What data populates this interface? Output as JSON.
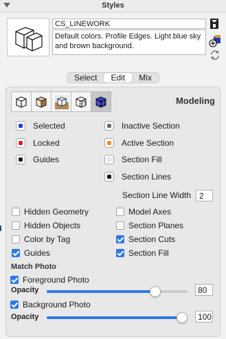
{
  "window": {
    "title": "Styles"
  },
  "style": {
    "name": "CS_LINEWORK",
    "description": "Default colors. Profile Edges. Light blue sky and brown background."
  },
  "tabs": [
    {
      "label": "Select",
      "active": false
    },
    {
      "label": "Edit",
      "active": true
    },
    {
      "label": "Mix",
      "active": false
    }
  ],
  "toolbar": {
    "buttons": [
      {
        "icon": "edge-settings-icon",
        "active": false
      },
      {
        "icon": "face-settings-icon",
        "active": false
      },
      {
        "icon": "background-settings-icon",
        "active": false
      },
      {
        "icon": "watermark-settings-icon",
        "active": false
      },
      {
        "icon": "modeling-settings-icon",
        "active": true
      }
    ],
    "section_title": "Modeling"
  },
  "colors": {
    "left": [
      {
        "label": "Selected",
        "color": "#1f3ed6"
      },
      {
        "label": "Locked",
        "color": "#e01c2a"
      },
      {
        "label": "Guides",
        "color": "#111111"
      }
    ],
    "right": [
      {
        "label": "Inactive Section",
        "color": "#6b6b6b"
      },
      {
        "label": "Active Section",
        "color": "#ee8a22"
      },
      {
        "label": "Section Fill",
        "color": "#f4f4f4"
      },
      {
        "label": "Section Lines",
        "color": "#111111"
      }
    ]
  },
  "section_line_width": {
    "label": "Section Line Width",
    "value": "2"
  },
  "checkboxes": {
    "left": [
      {
        "label": "Hidden Geometry",
        "checked": false
      },
      {
        "label": "Hidden Objects",
        "checked": false
      },
      {
        "label": "Color by Tag",
        "checked": false
      },
      {
        "label": "Guides",
        "checked": true
      }
    ],
    "right": [
      {
        "label": "Model Axes",
        "checked": false
      },
      {
        "label": "Section Planes",
        "checked": false
      },
      {
        "label": "Section Cuts",
        "checked": true
      },
      {
        "label": "Section Fill",
        "checked": true
      }
    ]
  },
  "match_photo": {
    "title": "Match Photo",
    "foreground": {
      "label": "Foreground Photo",
      "checked": true,
      "opacity_label": "Opacity",
      "value": "80",
      "fraction": 0.8
    },
    "background": {
      "label": "Background Photo",
      "checked": true,
      "opacity_label": "Opacity",
      "value": "100",
      "fraction": 1.0
    }
  },
  "accent_color": "#2e79e6"
}
